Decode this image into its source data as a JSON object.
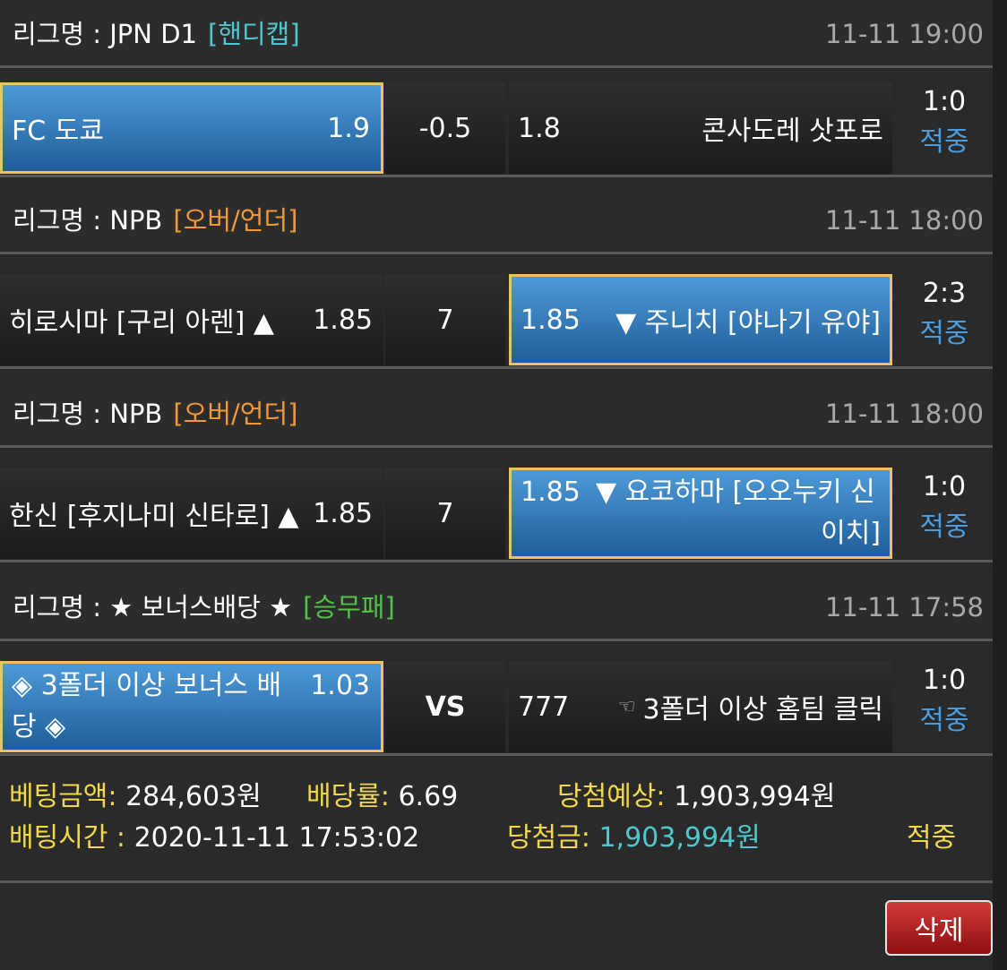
{
  "bets": [
    {
      "league_label": "리그명 : JPN D1",
      "bet_type": "[핸디캡]",
      "bet_type_color": "#4ec8d0",
      "datetime": "11-11 19:00",
      "home": "FC 도쿄",
      "home_odds": "1.9",
      "middle": "-0.5",
      "away_odds": "1.8",
      "away": "콘사도레 삿포로",
      "selected": "home",
      "score": "1:0",
      "status": "적중"
    },
    {
      "league_label": "리그명 : NPB",
      "bet_type": "[오버/언더]",
      "bet_type_color": "#f0983a",
      "datetime": "11-11 18:00",
      "home": "히로시마 [구리 아렌] ▲",
      "home_odds": "1.85",
      "middle": "7",
      "away_odds": "1.85",
      "away": "▼ 주니치 [야나기 유야]",
      "selected": "away",
      "score": "2:3",
      "status": "적중"
    },
    {
      "league_label": "리그명 : NPB",
      "bet_type": "[오버/언더]",
      "bet_type_color": "#f0983a",
      "datetime": "11-11 18:00",
      "home": "한신 [후지나미 신타로] ▲",
      "home_odds": "1.85",
      "middle": "7",
      "away_odds": "1.85",
      "away_line1": "▼ 요코하마 [오오누키 신",
      "away_line2": "이치]",
      "selected": "away",
      "score": "1:0",
      "status": "적중"
    },
    {
      "league_label": "리그명 : ★ 보너스배당 ★",
      "bet_type": "[승무패]",
      "bet_type_color": "#52c24a",
      "datetime": "11-11 17:58",
      "home_line1": "◈ 3폴더 이상 보너스 배",
      "home_line2": "당 ◈",
      "home_odds": "1.03",
      "middle": "VS",
      "away_odds": "777",
      "away_icon": "pointing-hand-icon",
      "away": "3폴더 이상 홈팀 클릭",
      "selected": "home",
      "score": "1:0",
      "status": "적중"
    }
  ],
  "summary": {
    "bet_amount_label": "베팅금액:",
    "bet_amount": "284,603원",
    "odds_label": "배당률:",
    "odds": "6.69",
    "expected_label": "당첨예상:",
    "expected": "1,903,994원",
    "time_label": "배팅시간 :",
    "time": "2020-11-11 17:53:02",
    "win_label": "당첨금:",
    "win": "1,903,994원",
    "result": "적중"
  },
  "delete_label": "삭제",
  "colors": {
    "selected_bg": "#3f86c6",
    "selected_border": "#e8c36a",
    "status_blue": "#4a9ee0",
    "label_yellow": "#f2d84a",
    "value_cyan": "#4ec8d0",
    "delete_red": "#b81f1f"
  }
}
